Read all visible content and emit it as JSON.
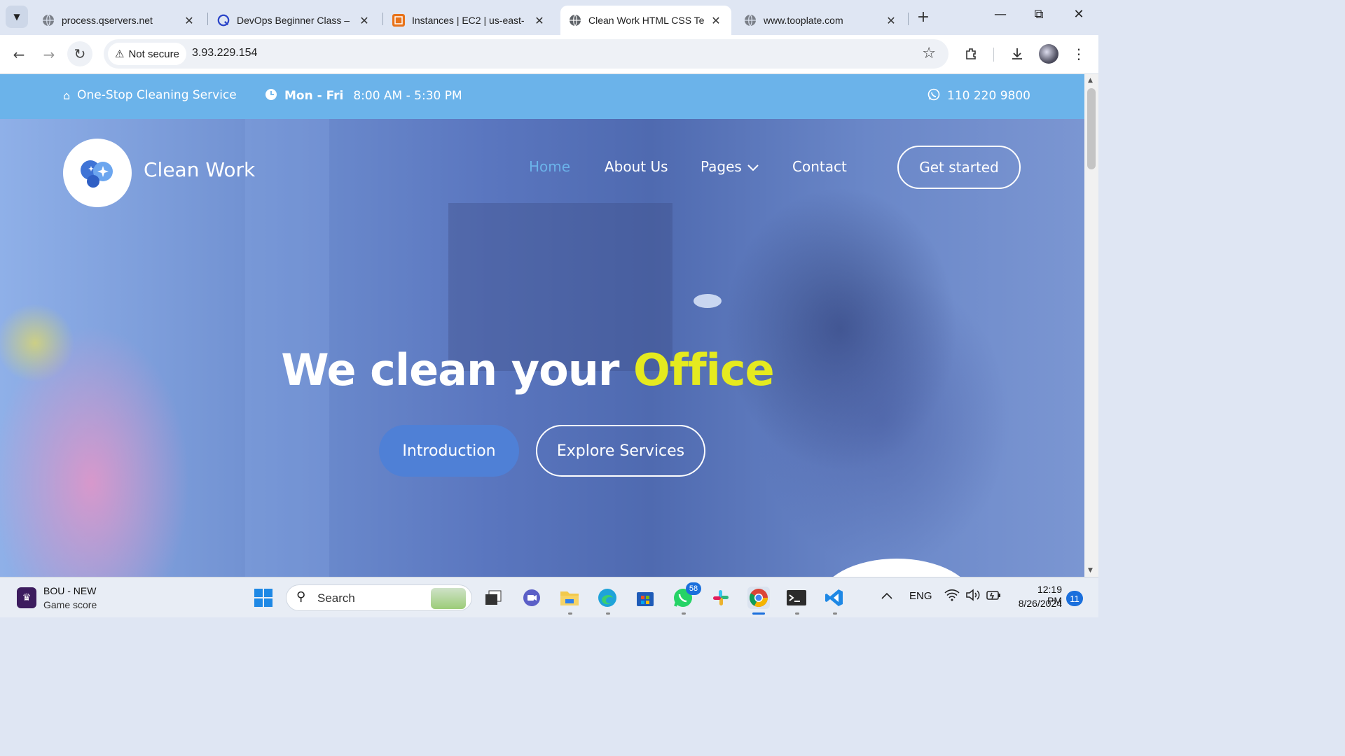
{
  "browser": {
    "tabs": [
      {
        "title": "process.qservers.net",
        "icon": "globe-icon",
        "active": false
      },
      {
        "title": "DevOps Beginner Class –",
        "icon": "devops-logo-icon",
        "active": false
      },
      {
        "title": "Instances | EC2 | us-east-",
        "icon": "aws-icon",
        "active": false
      },
      {
        "title": "Clean Work HTML CSS Te",
        "icon": "globe-icon",
        "active": true
      },
      {
        "title": "www.tooplate.com",
        "icon": "globe-icon",
        "active": false
      }
    ],
    "new_tab": "+",
    "security_label": "Not secure",
    "url": "3.93.229.154"
  },
  "site": {
    "topbar": {
      "tagline": "One-Stop Cleaning Service",
      "days": "Mon - Fri",
      "hours": "8:00 AM - 5:30 PM",
      "phone": "110 220 9800"
    },
    "brand": "Clean Work",
    "nav": {
      "home": "Home",
      "about": "About Us",
      "pages": "Pages",
      "contact": "Contact",
      "cta": "Get started"
    },
    "hero": {
      "headline_main": "We clean your",
      "headline_accent": "Office",
      "btn_primary": "Introduction",
      "btn_secondary": "Explore Services"
    },
    "colors": {
      "topbar": "#6bb3ea",
      "accent_yellow": "#e5ea1f",
      "primary_button": "#4f80d6",
      "active_nav": "#6bb3ea"
    }
  },
  "taskbar": {
    "widget_title": "BOU - NEW",
    "widget_subtitle": "Game score",
    "search_label": "Search",
    "whatsapp_badge": "58",
    "language": "ENG",
    "time": "12:19 PM",
    "date": "8/26/2024",
    "notifications": "11"
  }
}
